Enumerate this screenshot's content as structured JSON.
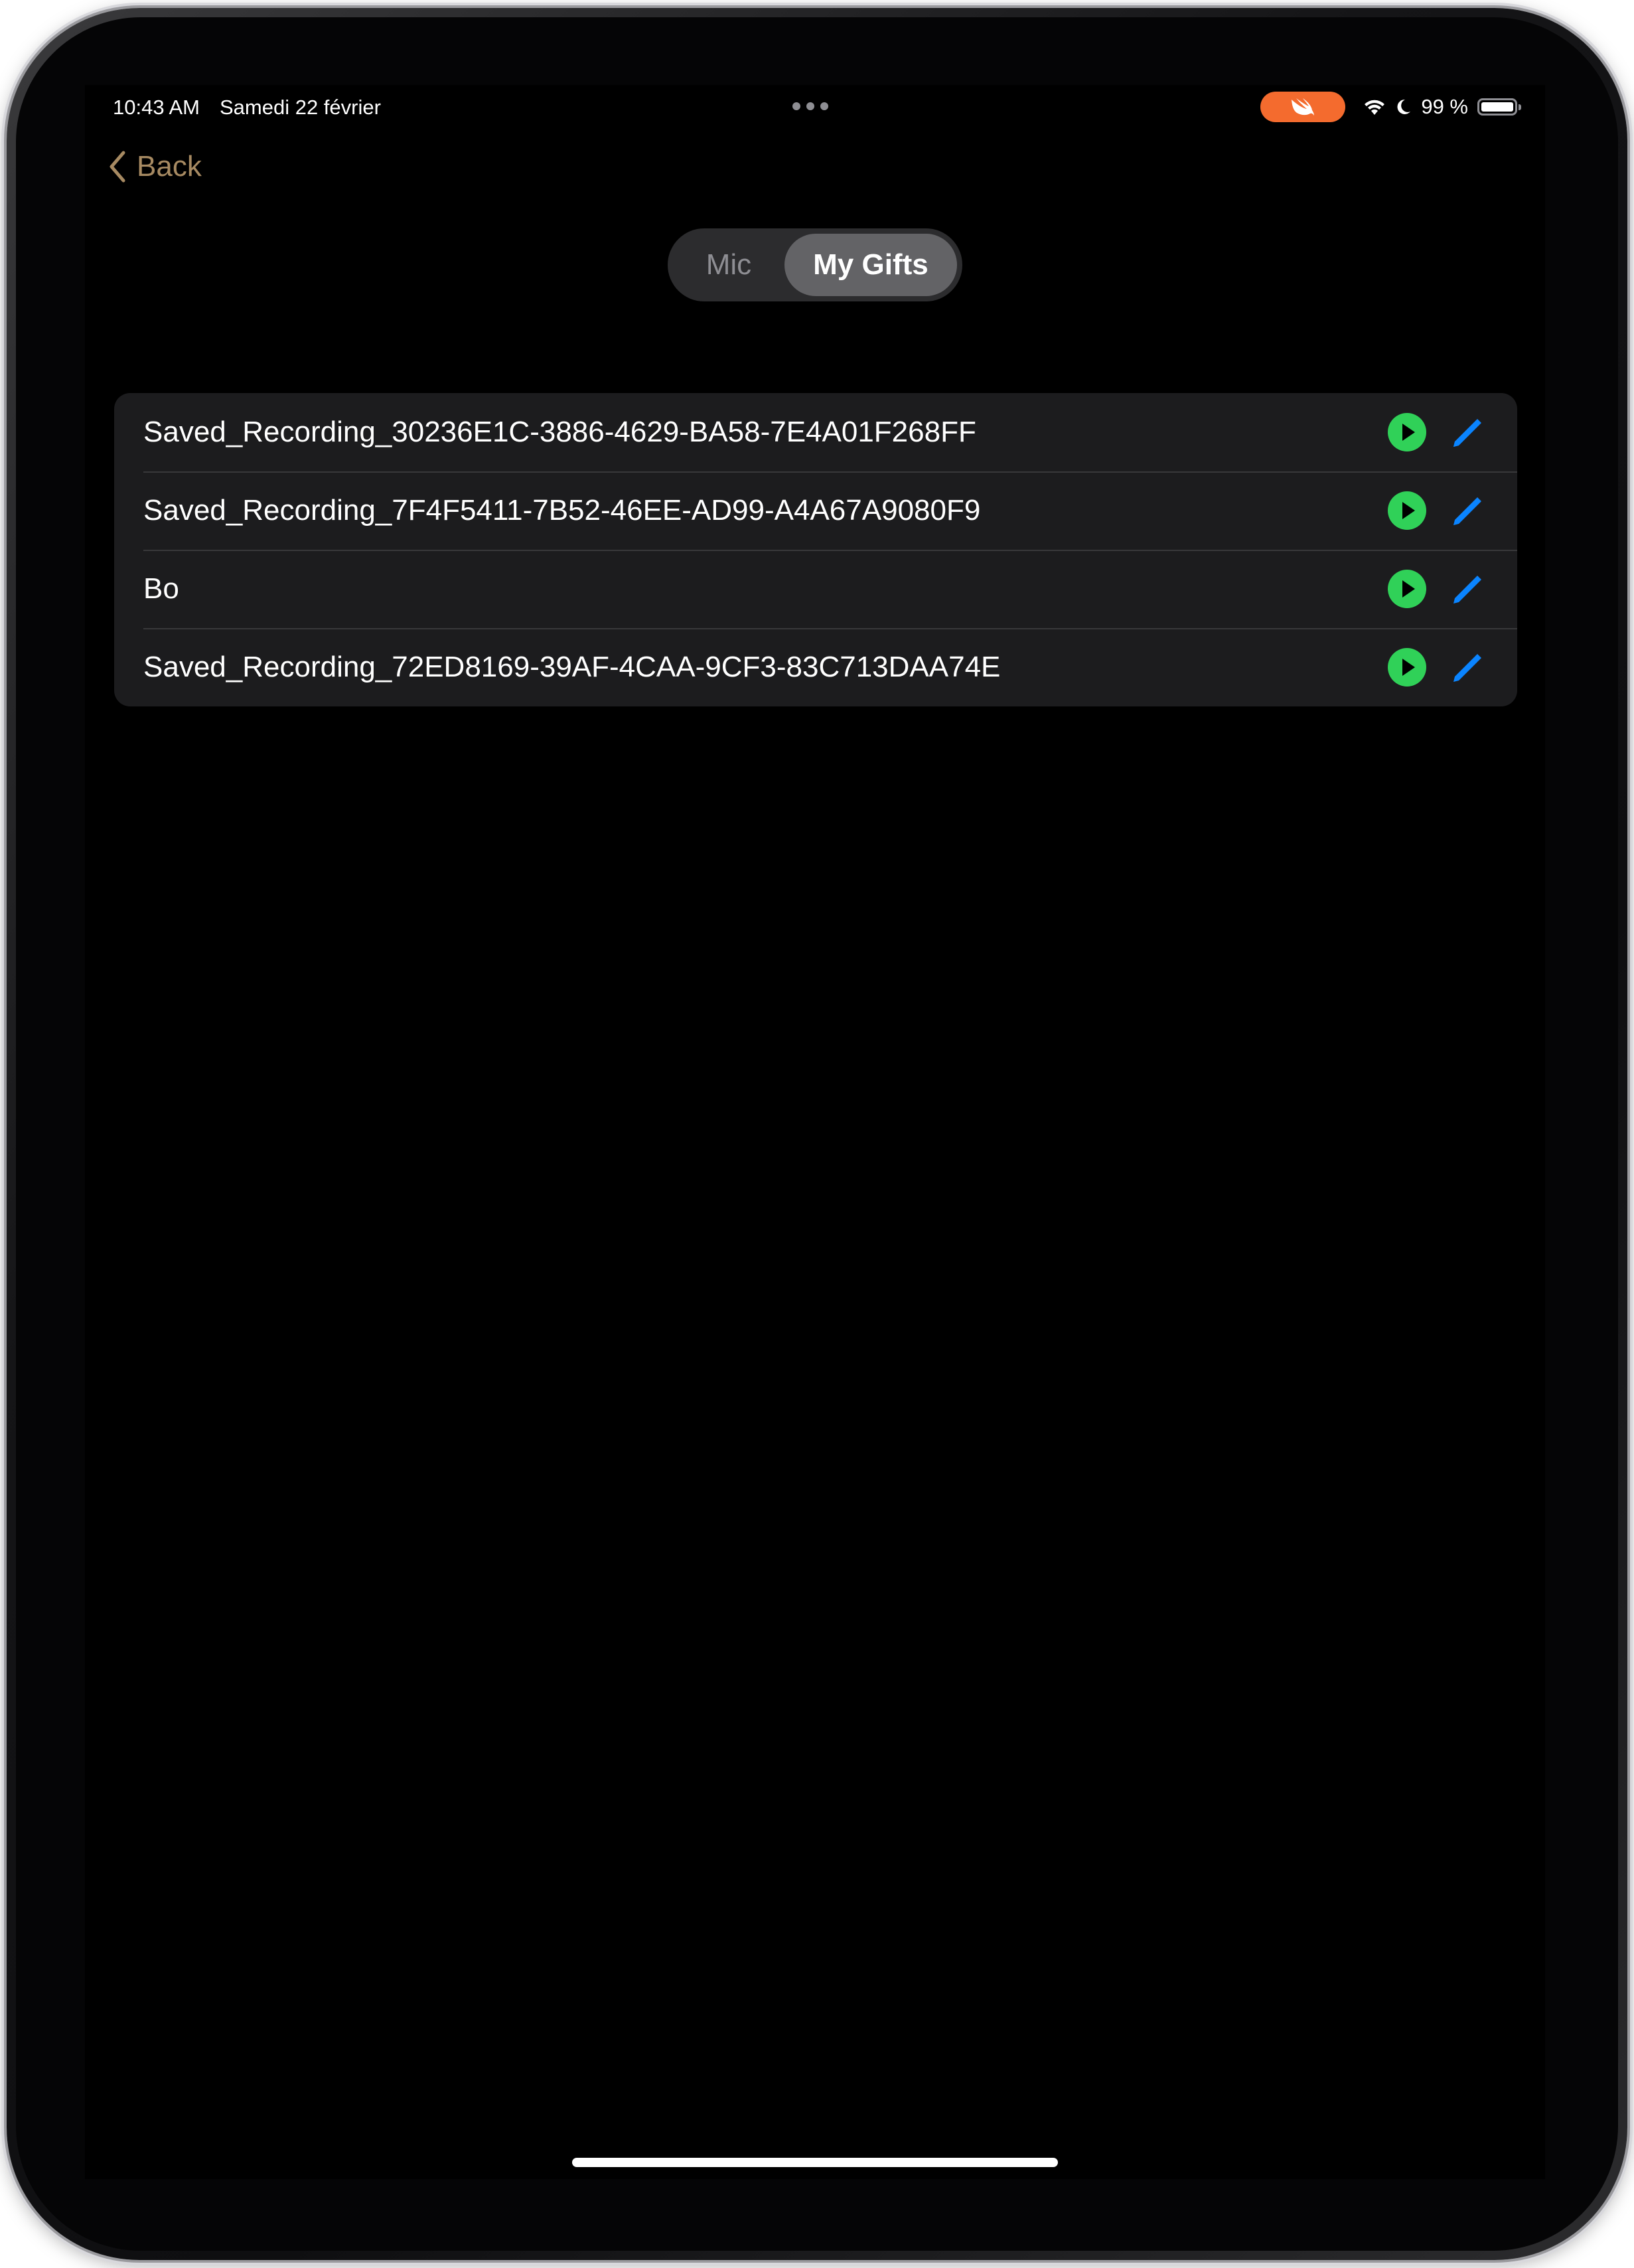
{
  "status_bar": {
    "time": "10:43 AM",
    "date": "Samedi 22 février",
    "battery": "99 %",
    "battery_level": 0.99
  },
  "nav": {
    "back_label": "Back"
  },
  "segmented": {
    "options": [
      "Mic",
      "My Gifts"
    ],
    "selected": "My Gifts"
  },
  "recordings": [
    {
      "title": "Saved_Recording_30236E1C-3886-4629-BA58-7E4A01F268FF"
    },
    {
      "title": "Saved_Recording_7F4F5411-7B52-46EE-AD99-A4A67A9080F9"
    },
    {
      "title": "Bo"
    },
    {
      "title": "Saved_Recording_72ED8169-39AF-4CAA-9CF3-83C713DAA74E"
    }
  ],
  "colors": {
    "accent_back": "#a78a62",
    "play": "#30d158",
    "edit": "#0a84ff",
    "swift_pill": "#f46b2e"
  },
  "icons": {
    "play": "play-circle-icon",
    "edit": "pencil-icon",
    "back": "chevron-left-icon"
  }
}
